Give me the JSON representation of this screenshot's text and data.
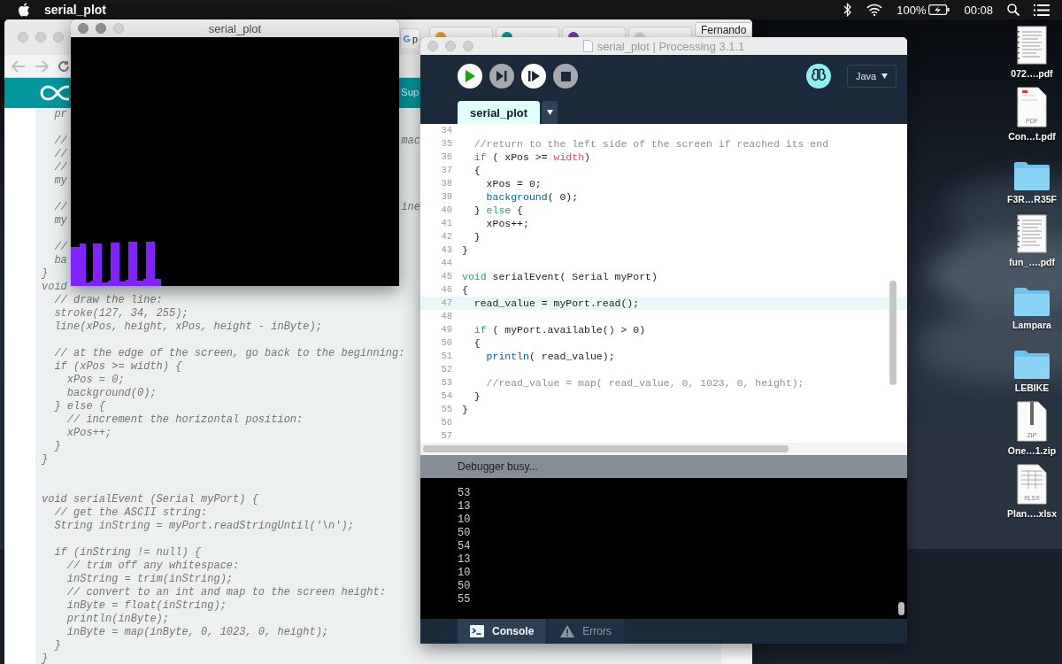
{
  "menu_bar": {
    "app_name": "serial_plot",
    "battery": "100%",
    "clock": "00:08"
  },
  "browser": {
    "profile_button": "Fernando",
    "tab": {
      "label": "p"
    },
    "header_link": "Sup",
    "code_lines": [
      {
        "kind": "code",
        "text": "  pr"
      },
      {
        "kind": "blank"
      },
      {
        "kind": "code",
        "text": "  //",
        "right": "mac"
      },
      {
        "kind": "code",
        "text": "  //"
      },
      {
        "kind": "code",
        "text": "  //"
      },
      {
        "kind": "code",
        "text": "  my"
      },
      {
        "kind": "blank"
      },
      {
        "kind": "code",
        "text": "  //",
        "right": "ine"
      },
      {
        "kind": "code",
        "text": "  my"
      },
      {
        "kind": "blank"
      },
      {
        "kind": "code",
        "text": "  //"
      },
      {
        "kind": "code",
        "text": "  ba"
      },
      {
        "text": "}"
      },
      {
        "text": "void"
      },
      {
        "text": "  // draw the line:"
      },
      {
        "text": "  stroke(127, 34, 255);"
      },
      {
        "text": "  line(xPos, height, xPos, height - inByte);"
      },
      {
        "kind": "blank"
      },
      {
        "text": "  // at the edge of the screen, go back to the beginning:"
      },
      {
        "text": "  if (xPos >= width) {"
      },
      {
        "text": "    xPos = 0;"
      },
      {
        "text": "    background(0);"
      },
      {
        "text": "  } else {"
      },
      {
        "text": "    // increment the horizontal position:"
      },
      {
        "text": "    xPos++;"
      },
      {
        "text": "  }"
      },
      {
        "text": "}"
      },
      {
        "kind": "blank"
      },
      {
        "kind": "blank"
      },
      {
        "text": "void serialEvent (Serial myPort) {"
      },
      {
        "text": "  // get the ASCII string:"
      },
      {
        "text": "  String inString = myPort.readStringUntil('\\n');"
      },
      {
        "kind": "blank"
      },
      {
        "text": "  if (inString != null) {"
      },
      {
        "text": "    // trim off any whitespace:"
      },
      {
        "text": "    inString = trim(inString);"
      },
      {
        "text": "    // convert to an int and map to the screen height:"
      },
      {
        "text": "    inByte = float(inString);"
      },
      {
        "text": "    println(inByte);"
      },
      {
        "text": "    inByte = map(inByte, 0, 1023, 0, height);"
      },
      {
        "text": "  }"
      },
      {
        "text": "}"
      }
    ]
  },
  "sketch_window": {
    "title": "serial_plot"
  },
  "processing": {
    "title": "serial_plot | Processing 3.1.1",
    "mode": "Java",
    "tabs": [
      {
        "label": "serial_plot",
        "selected": true
      }
    ],
    "lines": [
      {
        "number": "34",
        "current": false
      },
      {
        "number": "35",
        "current": false,
        "tokens": [
          {
            "kind": "comment",
            "text": "  //return to the left side of the screen if reached its end"
          }
        ]
      },
      {
        "number": "36",
        "current": false,
        "tokens": [
          {
            "kind": "keyword",
            "text": "  if"
          },
          {
            "kind": "plain",
            "text": " ( xPos >= "
          },
          {
            "kind": "constant",
            "text": "width"
          },
          {
            "kind": "plain",
            "text": ")"
          }
        ]
      },
      {
        "number": "37",
        "current": false,
        "tokens": [
          {
            "kind": "plain",
            "text": "  {"
          }
        ]
      },
      {
        "number": "38",
        "current": false,
        "tokens": [
          {
            "kind": "plain",
            "text": "    xPos = 0;"
          }
        ]
      },
      {
        "number": "39",
        "current": false,
        "tokens": [
          {
            "kind": "function",
            "text": "    background"
          },
          {
            "kind": "plain",
            "text": "( 0);"
          }
        ]
      },
      {
        "number": "40",
        "current": false,
        "tokens": [
          {
            "kind": "plain",
            "text": "  } "
          },
          {
            "kind": "keyword",
            "text": "else"
          },
          {
            "kind": "plain",
            "text": " {"
          }
        ]
      },
      {
        "number": "41",
        "current": false,
        "tokens": [
          {
            "kind": "plain",
            "text": "    xPos++;"
          }
        ]
      },
      {
        "number": "42",
        "current": false,
        "tokens": [
          {
            "kind": "plain",
            "text": "  }"
          }
        ]
      },
      {
        "number": "43",
        "current": false,
        "tokens": [
          {
            "kind": "plain",
            "text": "}"
          }
        ]
      },
      {
        "number": "44",
        "current": false
      },
      {
        "number": "45",
        "current": false,
        "tokens": [
          {
            "kind": "keyword",
            "text": "void"
          },
          {
            "kind": "plain",
            "text": " serialEvent( Serial myPort)"
          }
        ]
      },
      {
        "number": "46",
        "current": false,
        "tokens": [
          {
            "kind": "plain",
            "text": "{"
          }
        ]
      },
      {
        "number": "47",
        "current": true,
        "tokens": [
          {
            "kind": "plain",
            "text": "  read_value = myPort.read();"
          }
        ]
      },
      {
        "number": "48",
        "current": false
      },
      {
        "number": "49",
        "current": false,
        "tokens": [
          {
            "kind": "keyword",
            "text": "  if"
          },
          {
            "kind": "plain",
            "text": " ( myPort.available() > 0)"
          }
        ]
      },
      {
        "number": "50",
        "current": false,
        "tokens": [
          {
            "kind": "plain",
            "text": "  {"
          }
        ]
      },
      {
        "number": "51",
        "current": false,
        "tokens": [
          {
            "kind": "function",
            "text": "    println"
          },
          {
            "kind": "plain",
            "text": "( read_value);"
          }
        ]
      },
      {
        "number": "52",
        "current": false
      },
      {
        "number": "53",
        "current": false,
        "tokens": [
          {
            "kind": "comment",
            "text": "    //read_value = map( read_value, 0, 1023, 0, height);"
          }
        ]
      },
      {
        "number": "54",
        "current": false,
        "tokens": [
          {
            "kind": "plain",
            "text": "  }"
          }
        ]
      },
      {
        "number": "55",
        "current": false,
        "tokens": [
          {
            "kind": "plain",
            "text": "}"
          }
        ]
      },
      {
        "number": "56",
        "current": false
      },
      {
        "number": "57",
        "current": false
      }
    ],
    "status": "Debugger busy...",
    "console_lines": [
      "53",
      "13",
      "10",
      "50",
      "54",
      "13",
      "10",
      "50",
      "55"
    ],
    "panel_tabs": [
      {
        "label": "Console",
        "kind": "console",
        "selected": true
      },
      {
        "label": "Errors",
        "kind": "errors",
        "selected": false
      }
    ]
  },
  "desktop_icons": [
    {
      "label": "072….pdf",
      "kind": "document"
    },
    {
      "label": "Con…t.pdf",
      "kind": "pdf",
      "badge": "PDF"
    },
    {
      "label": "F3R…R35F",
      "kind": "folder"
    },
    {
      "label": "fun_….pdf",
      "kind": "document"
    },
    {
      "label": "Lampara",
      "kind": "folder"
    },
    {
      "label": "LEBIKE",
      "kind": "folder"
    },
    {
      "label": "One…1.zip",
      "kind": "zip",
      "badge": "ZIP"
    },
    {
      "label": "Plan….xlsx",
      "kind": "spreadsheet",
      "badge": "XLSX"
    }
  ]
}
